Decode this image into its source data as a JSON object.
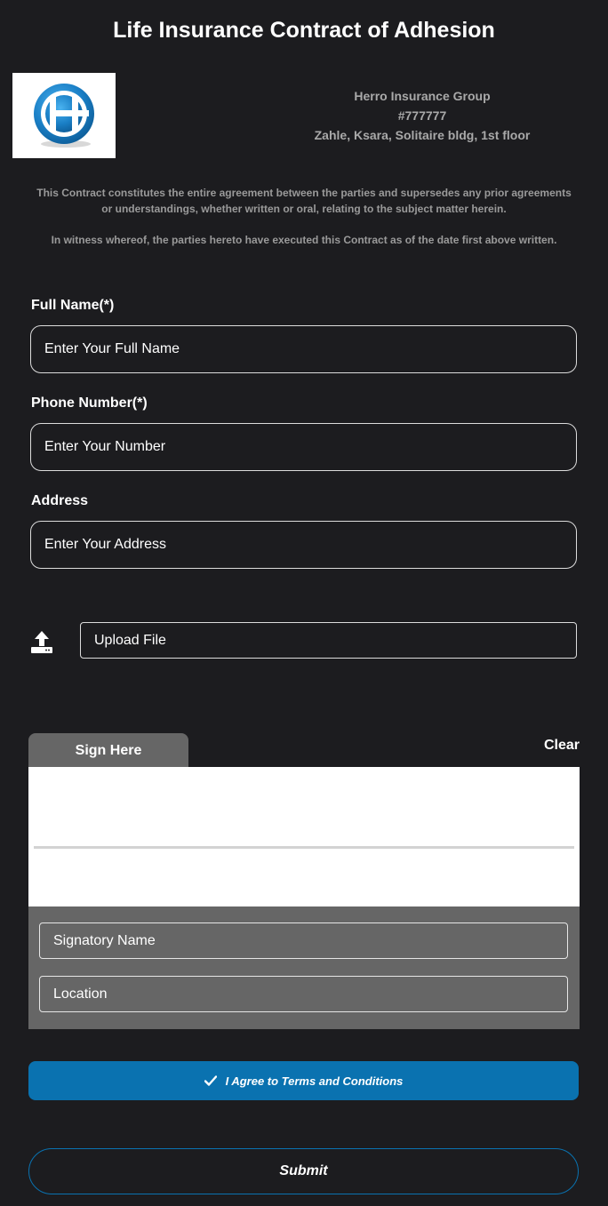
{
  "page": {
    "title": "Life Insurance Contract of Adhesion"
  },
  "company": {
    "name": "Herro Insurance Group",
    "number": "#777777",
    "address": "Zahle, Ksara, Solitaire bldg, 1st floor",
    "logo_icon": "company-logo-icon"
  },
  "terms": {
    "paragraph1": "This Contract constitutes the entire agreement between the parties and supersedes any prior agreements or understandings, whether written or oral, relating to the subject matter herein.",
    "paragraph2": "In witness whereof, the parties hereto have executed this Contract as of the date first above written."
  },
  "form": {
    "full_name": {
      "label": "Full Name(*)",
      "placeholder": "Enter Your Full Name",
      "value": ""
    },
    "phone": {
      "label": "Phone Number(*)",
      "placeholder": "Enter Your Number",
      "value": ""
    },
    "address": {
      "label": "Address",
      "placeholder": "Enter Your Address",
      "value": ""
    }
  },
  "upload": {
    "label": "Upload File",
    "icon": "upload-icon"
  },
  "signature": {
    "tab_label": "Sign Here",
    "clear_label": "Clear",
    "signatory_placeholder": "Signatory Name",
    "location_placeholder": "Location"
  },
  "agreement": {
    "label": "I Agree to Terms and Conditions",
    "checked": true,
    "icon": "check-icon"
  },
  "submit": {
    "label": "Submit"
  },
  "colors": {
    "background": "#1c1c1f",
    "accent": "#0a72b0",
    "panel": "#666666",
    "muted_text": "#a9a9a9"
  }
}
